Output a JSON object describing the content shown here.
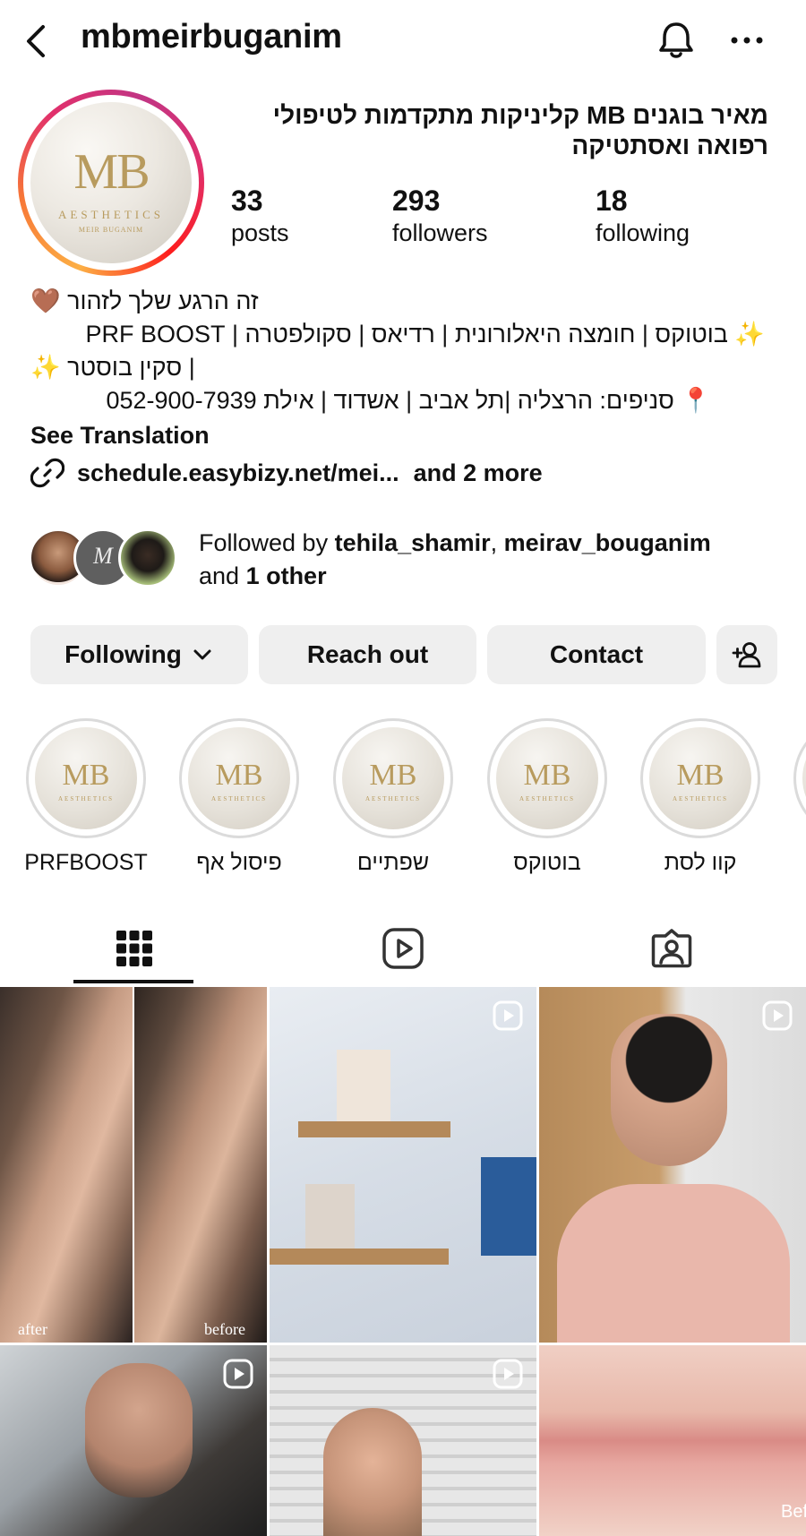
{
  "header": {
    "username": "mbmeirbuganim",
    "icons": {
      "back": "chevron-left-icon",
      "notifications": "bell-icon",
      "more": "more-horizontal-icon"
    }
  },
  "profile": {
    "avatar_logo_text": "MB",
    "avatar_logo_sub": "AESTHETICS",
    "avatar_logo_name": "MEIR BUGANIM",
    "name": "מאיר בוגנים MB קליניקות מתקדמות לטיפולי רפואה ואסתטיקה",
    "stats": [
      {
        "value": "33",
        "label": "posts"
      },
      {
        "value": "293",
        "label": "followers"
      },
      {
        "value": "18",
        "label": "following"
      }
    ]
  },
  "bio": {
    "line1": "זה הרגע שלך לזהור 🤎",
    "line2": "✨ בוטוקס | חומצה היאלורונית | רדיאס | סקולפטרה | PRF BOOST",
    "line3": "| סקין בוסטר ✨",
    "line4": "📍 סניפים: הרצליה |תל אביב | אשדוד | אילת 052-900-7939",
    "see_translation": "See Translation",
    "link": "schedule.easybizy.net/mei...",
    "link_more": "and 2 more"
  },
  "followed_by": {
    "prefix": "Followed by ",
    "user1": "tehila_shamir",
    "separator": ", ",
    "user2": "meirav_bouganim",
    "and": "and ",
    "others": "1 other"
  },
  "buttons": {
    "following": "Following",
    "reach_out": "Reach out",
    "contact": "Contact"
  },
  "highlights": [
    {
      "label": "PRFBOOST"
    },
    {
      "label": "פיסול אף"
    },
    {
      "label": "שפתיים"
    },
    {
      "label": "בוטוקס"
    },
    {
      "label": "קוו לסת"
    }
  ],
  "tabs": [
    "grid-icon",
    "reels-icon",
    "tagged-icon"
  ],
  "posts": {
    "p1_left_caption": "after",
    "p1_right_caption": "before",
    "p6_caption": "Bef"
  },
  "colors": {
    "button_bg": "#efefef",
    "text": "#111111",
    "ring_gradient": [
      "#fcaf45",
      "#e1306c",
      "#c13584"
    ],
    "gold": "#b89b5e"
  }
}
